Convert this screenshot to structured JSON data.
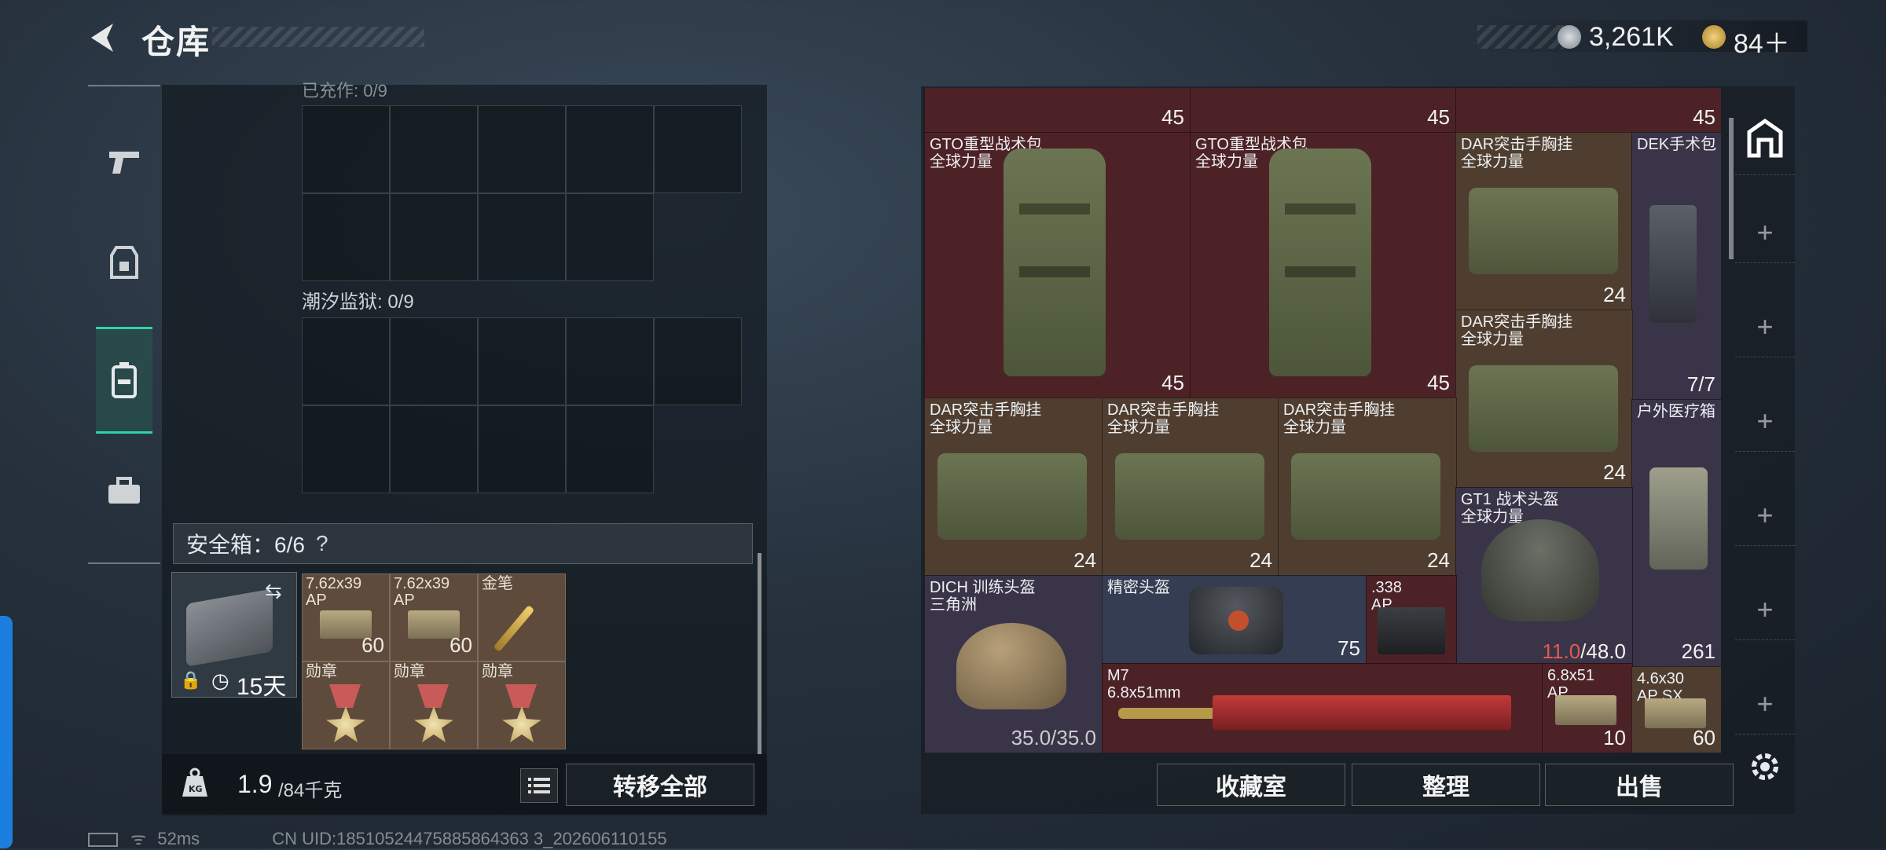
{
  "header": {
    "title": "仓库",
    "currency": [
      {
        "icon": "silver-coin-icon",
        "value": "3,261K"
      },
      {
        "icon": "gold-coin-icon",
        "value": "84＋"
      }
    ]
  },
  "nav": [
    {
      "icon": "pistol-icon"
    },
    {
      "icon": "armor-vest-icon"
    },
    {
      "icon": "backpack-icon",
      "active": true
    },
    {
      "icon": "toolbox-icon"
    }
  ],
  "left": {
    "section1_label": "已充作: 0/9",
    "section2_label": "潮汐监狱: 0/9",
    "safe_label": "安全箱：6/6",
    "safe_help": "?",
    "safebox_days": "15天",
    "safe_items": [
      {
        "name": "7.62x39\nAP",
        "qty": "60"
      },
      {
        "name": "7.62x39\nAP",
        "qty": "60"
      },
      {
        "name": "金笔",
        "qty": ""
      },
      {
        "name": "勋章",
        "qty": ""
      },
      {
        "name": "勋章",
        "qty": ""
      },
      {
        "name": "勋章",
        "qty": ""
      }
    ],
    "weight": "1.9",
    "weight_max": "/84千克",
    "transfer_all": "转移全部"
  },
  "stash": {
    "top_row_qty": [
      "45",
      "45",
      "45"
    ],
    "items": [
      {
        "name": "GTO重型战术包\n全球力量",
        "qty": "45"
      },
      {
        "name": "GTO重型战术包\n全球力量",
        "qty": "45"
      },
      {
        "name": "DAR突击手胸挂\n全球力量",
        "qty": "24"
      },
      {
        "name": "DEK手术包",
        "qty": "7/7"
      },
      {
        "name": "DAR突击手胸挂\n全球力量",
        "qty": "24"
      },
      {
        "name": "DAR突击手胸挂\n全球力量",
        "qty": "24"
      },
      {
        "name": "DAR突击手胸挂\n全球力量",
        "qty": "24"
      },
      {
        "name": "DAR突击手胸挂\n全球力量",
        "qty": "24"
      },
      {
        "name": "户外医疗箱",
        "qty": "261"
      },
      {
        "name": "GT1 战术头盔\n全球力量",
        "qty_cur": "11.0",
        "qty_max": "/48.0"
      },
      {
        "name": "DICH 训练头盔\n三角洲",
        "qty": "35.0/35.0"
      },
      {
        "name": "精密头盔",
        "qty": "75"
      },
      {
        "name": ".338\nAP",
        "qty": ""
      },
      {
        "name": "M7\n6.8x51mm",
        "qty": ""
      },
      {
        "name": "6.8x51\nAP",
        "qty": "10"
      },
      {
        "name": "4.6x30\nAP SX",
        "qty": "60"
      }
    ],
    "buttons": {
      "collection": "收藏室",
      "sort": "整理",
      "sell": "出售"
    }
  },
  "status": {
    "ping": "52ms",
    "uid": "CN UID:18510524475885864363 3_202606110155"
  },
  "colors": {
    "accent": "#2fd3a6",
    "red_tier": "#4d2226",
    "brown_tier": "#4f3e30",
    "purple_tier": "#3a3448"
  }
}
